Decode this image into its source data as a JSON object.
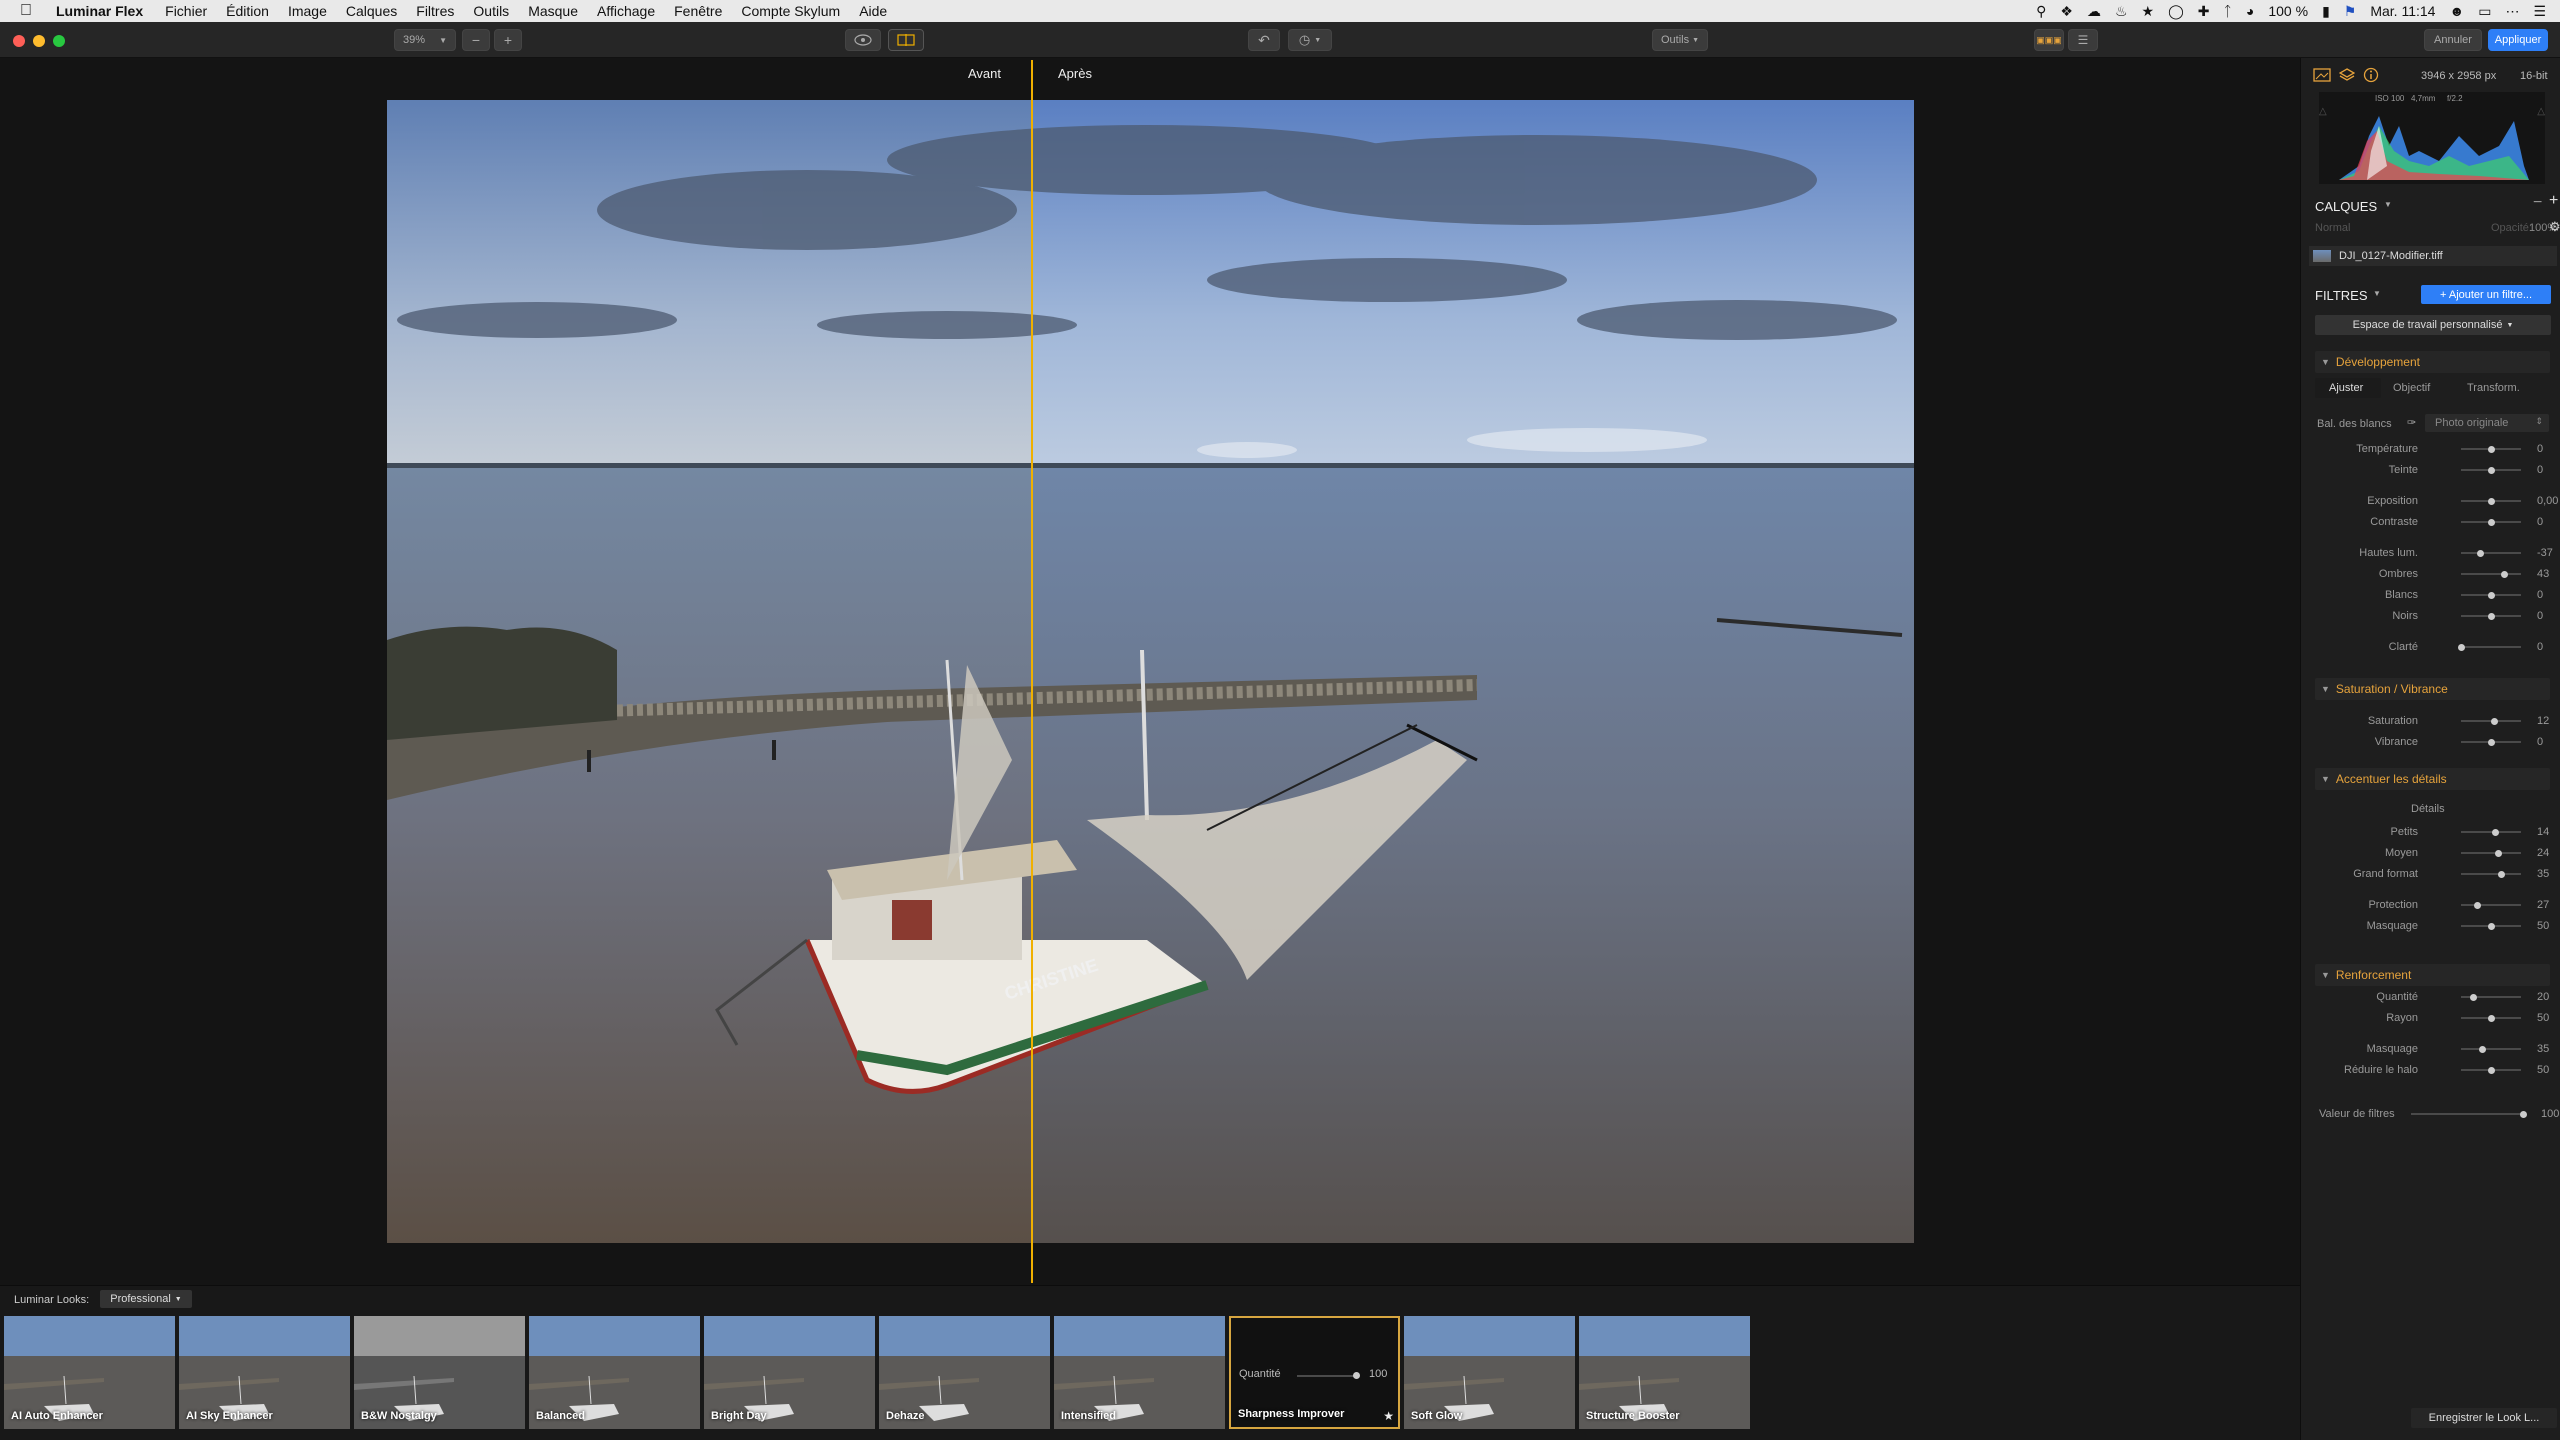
{
  "menubar": {
    "app": "Luminar Flex",
    "items": [
      "Fichier",
      "Édition",
      "Image",
      "Calques",
      "Outils",
      "Filtres",
      "Outils",
      "Masque",
      "Affichage",
      "Fenêtre",
      "Compte Skylum",
      "Aide"
    ],
    "menus": [
      "Fichier",
      "Édition",
      "Image",
      "Calques",
      "Filtres",
      "Outils",
      "Masque",
      "Affichage",
      "Fenêtre",
      "Compte Skylum",
      "Aide"
    ],
    "battery": "100 %",
    "clock": "Mar. 11:14"
  },
  "toolbar": {
    "zoom": "39%",
    "tools_label": "Outils",
    "cancel_label": "Annuler",
    "apply_label": "Appliquer"
  },
  "compare": {
    "before": "Avant",
    "after": "Après",
    "split_fraction": 0.42
  },
  "info": {
    "dimensions": "3946 x 2958 px",
    "bitdepth": "16-bit",
    "iso": "ISO 100",
    "focal": "4,7mm",
    "aperture": "f/2.2"
  },
  "layers": {
    "title": "CALQUES",
    "blend": "Normal",
    "opacity_label": "Opacité:",
    "opacity": "100%",
    "layer_name": "DJI_0127-Modifier.tiff"
  },
  "filters": {
    "title": "FILTRES",
    "add_button": "+ Ajouter un filtre...",
    "workspace": "Espace de travail personnalisé"
  },
  "development": {
    "title": "Développement",
    "tabs": [
      "Ajuster",
      "Objectif",
      "Transform."
    ],
    "wb_label": "Bal. des blancs",
    "wb_value": "Photo originale",
    "sliders": [
      {
        "label": "Température",
        "value": "0",
        "pos": 0.5
      },
      {
        "label": "Teinte",
        "value": "0",
        "pos": 0.5
      },
      {
        "label": "Exposition",
        "value": "0,00",
        "pos": 0.5
      },
      {
        "label": "Contraste",
        "value": "0",
        "pos": 0.5
      },
      {
        "label": "Hautes lum.",
        "value": "-37",
        "pos": 0.32
      },
      {
        "label": "Ombres",
        "value": "43",
        "pos": 0.72
      },
      {
        "label": "Blancs",
        "value": "0",
        "pos": 0.5
      },
      {
        "label": "Noirs",
        "value": "0",
        "pos": 0.5
      },
      {
        "label": "Clarté",
        "value": "0",
        "pos": 0.0
      }
    ]
  },
  "saturation": {
    "title": "Saturation / Vibrance",
    "sliders": [
      {
        "label": "Saturation",
        "value": "12",
        "pos": 0.56
      },
      {
        "label": "Vibrance",
        "value": "0",
        "pos": 0.5
      }
    ]
  },
  "details": {
    "title": "Accentuer les détails",
    "subtitle": "Détails",
    "sliders": [
      {
        "label": "Petits",
        "value": "14",
        "pos": 0.57
      },
      {
        "label": "Moyen",
        "value": "24",
        "pos": 0.62
      },
      {
        "label": "Grand format",
        "value": "35",
        "pos": 0.68
      },
      {
        "label": "Protection",
        "value": "27",
        "pos": 0.27
      },
      {
        "label": "Masquage",
        "value": "50",
        "pos": 0.5
      }
    ]
  },
  "sharpen": {
    "title": "Renforcement",
    "sliders": [
      {
        "label": "Quantité",
        "value": "20",
        "pos": 0.2
      },
      {
        "label": "Rayon",
        "value": "50",
        "pos": 0.5
      },
      {
        "label": "Masquage",
        "value": "35",
        "pos": 0.35
      },
      {
        "label": "Réduire le halo",
        "value": "50",
        "pos": 0.5
      }
    ]
  },
  "filter_amount": {
    "label": "Valeur de filtres",
    "value": "100",
    "pos": 1.0
  },
  "looks": {
    "label": "Luminar Looks:",
    "category": "Professional",
    "items": [
      "AI Auto Enhancer",
      "AI Sky Enhancer",
      "B&W Nostalgy",
      "Balanced",
      "Bright Day",
      "Dehaze",
      "Intensified",
      "Sharpness Improver",
      "Soft Glow",
      "Structure Booster"
    ],
    "selected_quantity_label": "Quantité",
    "selected_quantity_value": "100",
    "save_label": "Enregistrer le Look L..."
  }
}
